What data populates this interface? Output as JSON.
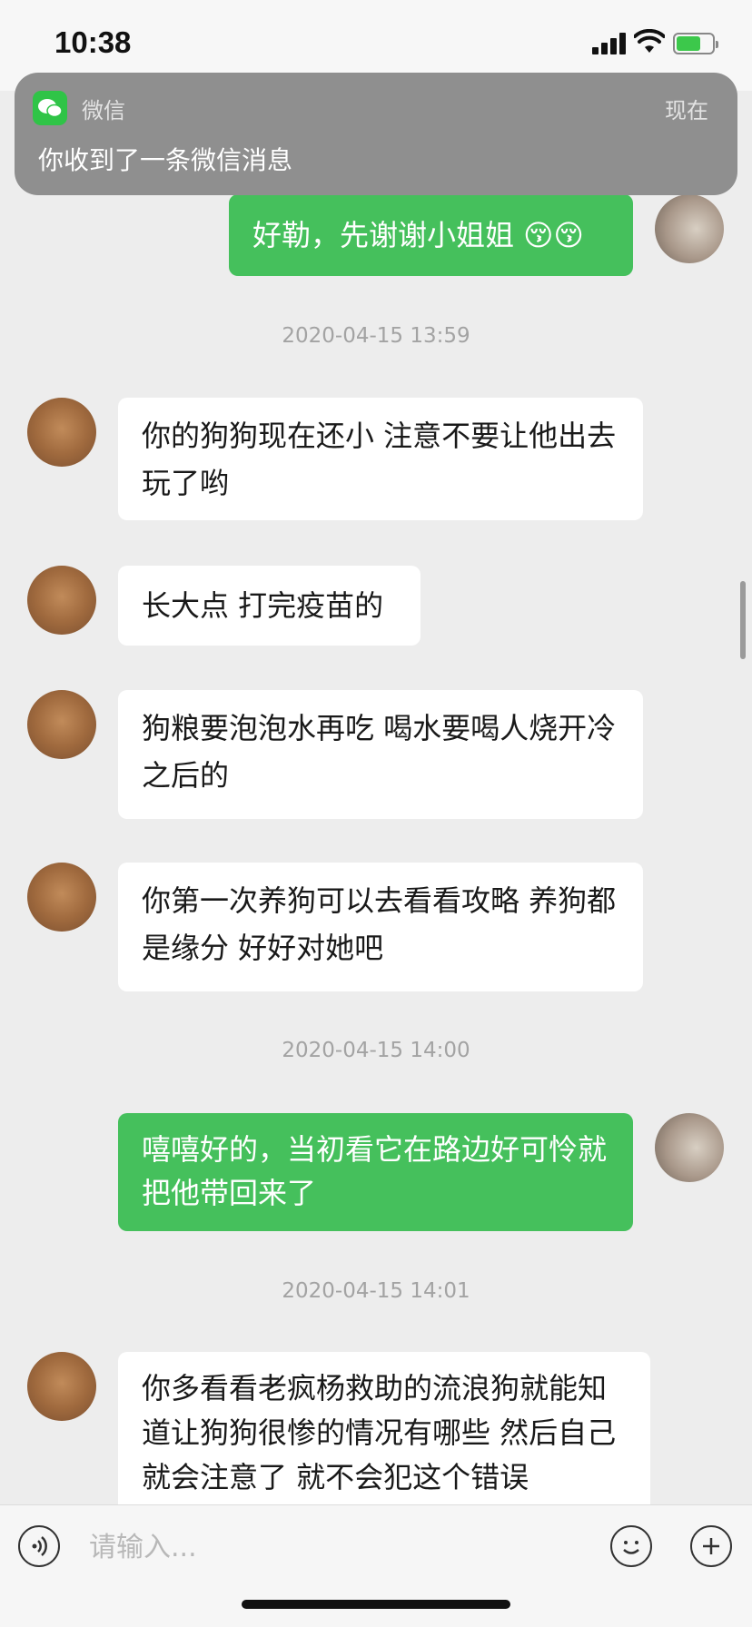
{
  "status_bar": {
    "time": "10:38"
  },
  "notification": {
    "app_name": "微信",
    "time": "现在",
    "message": "你收到了一条微信消息"
  },
  "chat": {
    "messages": [
      {
        "sender": "me",
        "text": "好勒，先谢谢小姐姐 😚😚"
      },
      {
        "sender": "timestamp",
        "text": "2020-04-15 13:59"
      },
      {
        "sender": "them",
        "text": "你的狗狗现在还小 注意不要让他出去玩了哟"
      },
      {
        "sender": "them",
        "text": "长大点 打完疫苗的"
      },
      {
        "sender": "them",
        "text": "狗粮要泡泡水再吃 喝水要喝人烧开冷之后的"
      },
      {
        "sender": "them",
        "text": "你第一次养狗可以去看看攻略 养狗都是缘分 好好对她吧"
      },
      {
        "sender": "timestamp",
        "text": "2020-04-15 14:00"
      },
      {
        "sender": "me",
        "text": "嘻嘻好的，当初看它在路边好可怜就把他带回来了"
      },
      {
        "sender": "timestamp",
        "text": "2020-04-15 14:01"
      },
      {
        "sender": "them",
        "text": "你多看看老疯杨救助的流浪狗就能知道让狗狗很惨的情况有哪些 然后自己就会注意了  就不会犯这个错误"
      }
    ]
  },
  "input_bar": {
    "placeholder": "请输入..."
  },
  "icons": {
    "voice": "voice-icon",
    "emoji": "emoji-icon",
    "plus": "plus-icon",
    "wechat": "wechat-icon"
  },
  "colors": {
    "my_bubble": "#45c05c",
    "their_bubble": "#ffffff",
    "background": "#ededed"
  }
}
